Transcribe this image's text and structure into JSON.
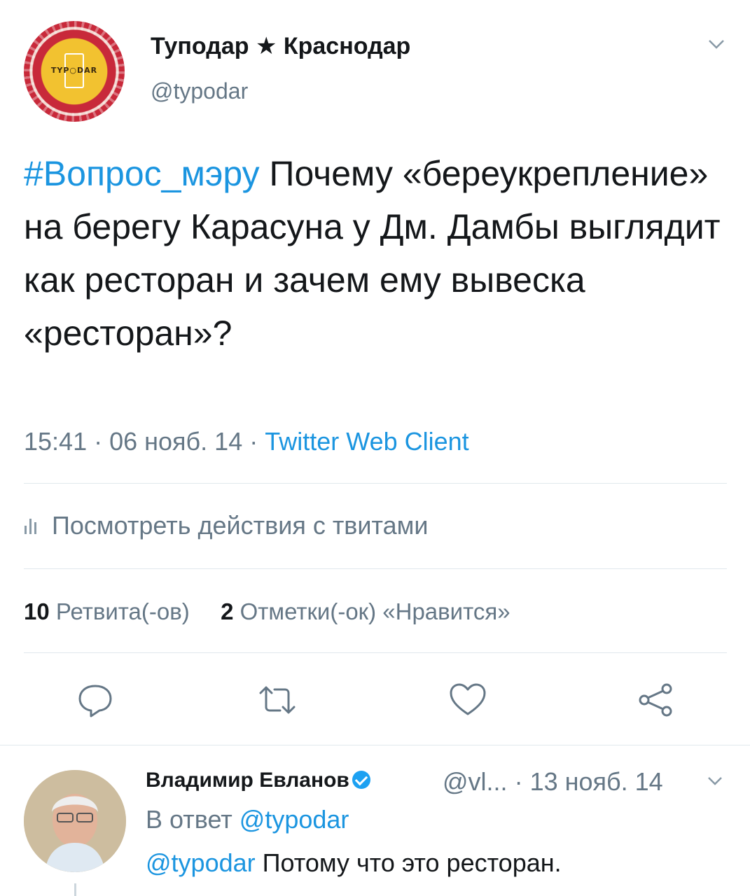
{
  "tweet": {
    "author_name": "Туподар ★ Краснодар",
    "author_handle": "@typodar",
    "avatar_logo": "TYP○DAR",
    "hashtag": "#Вопрос_мэру",
    "text": " Почему «береукрепление» на берегу Карасуна у Дм. Дамбы выглядит как ресторан и зачем ему вывеска «ресторан»?",
    "time": "15:41",
    "date": "06 нояб. 14",
    "source": "Twitter Web Client",
    "activity_label": "Посмотреть действия с твитами",
    "retweets_count": "10",
    "retweets_label": "Ретвита(-ов)",
    "likes_count": "2",
    "likes_label": "Отметки(-ок) «Нравится»"
  },
  "actions": [
    {
      "name": "reply-icon"
    },
    {
      "name": "retweet-icon"
    },
    {
      "name": "like-icon"
    },
    {
      "name": "share-icon"
    }
  ],
  "reply": {
    "author_name": "Владимир Евланов",
    "author_handle": "@vl...",
    "date": "13 нояб. 14",
    "reply_to_prefix": "В ответ",
    "reply_to_handle": "@typodar",
    "mention": "@typodar",
    "text": " Потому что это ресторан."
  },
  "colors": {
    "accent": "#1b95e0",
    "secondary_text": "#657786",
    "divider": "#e1e8ed"
  }
}
